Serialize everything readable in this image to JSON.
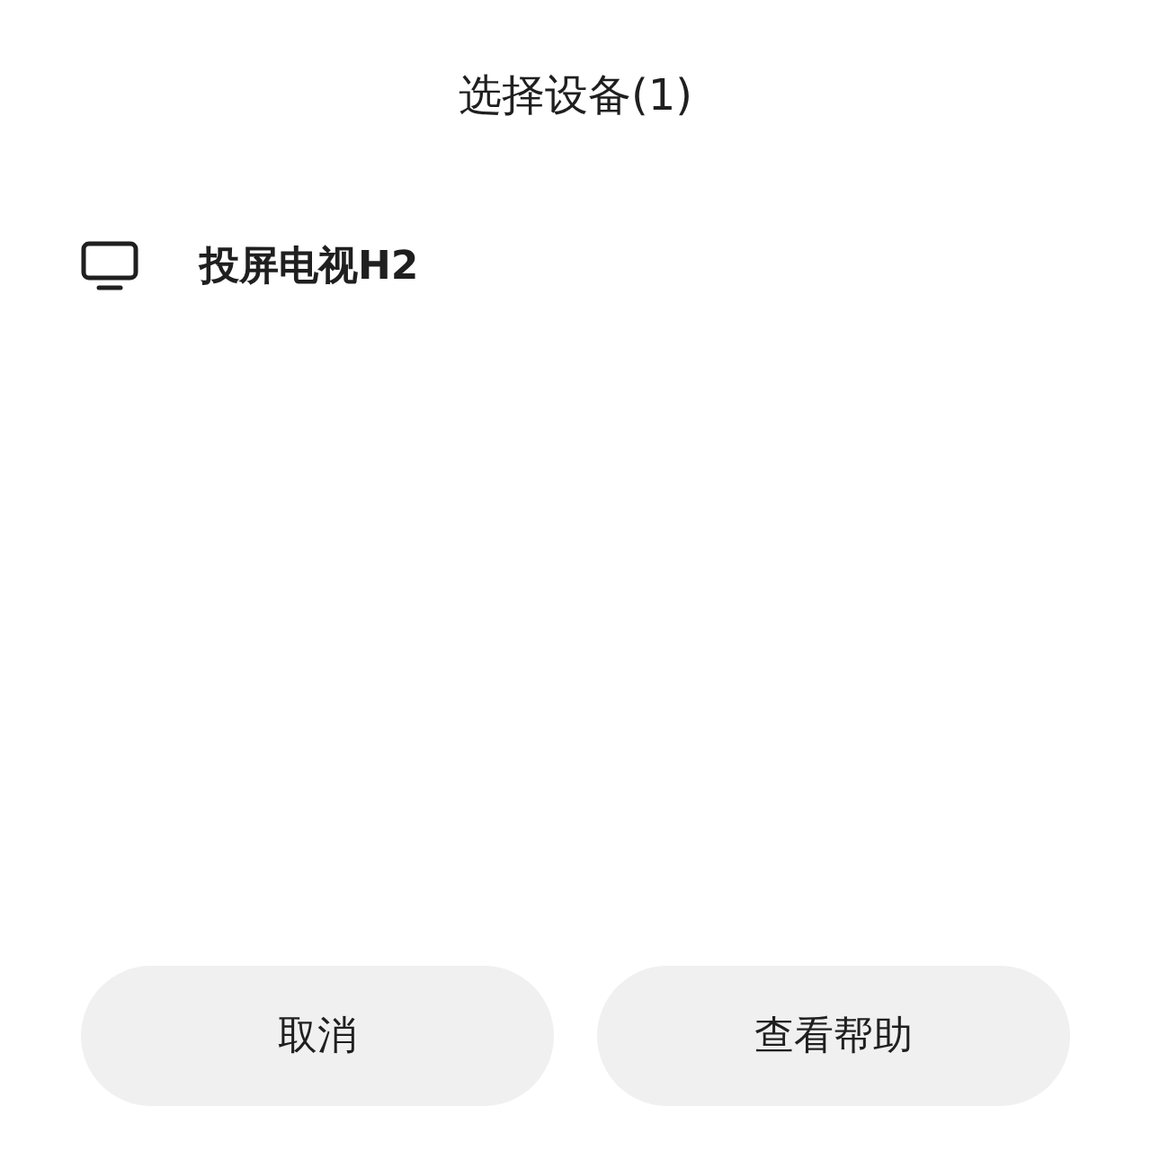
{
  "title": "选择设备(1)",
  "devices": [
    {
      "name": "投屏电视H2"
    }
  ],
  "buttons": [
    {
      "label": "取消"
    },
    {
      "label": "查看帮助"
    }
  ]
}
